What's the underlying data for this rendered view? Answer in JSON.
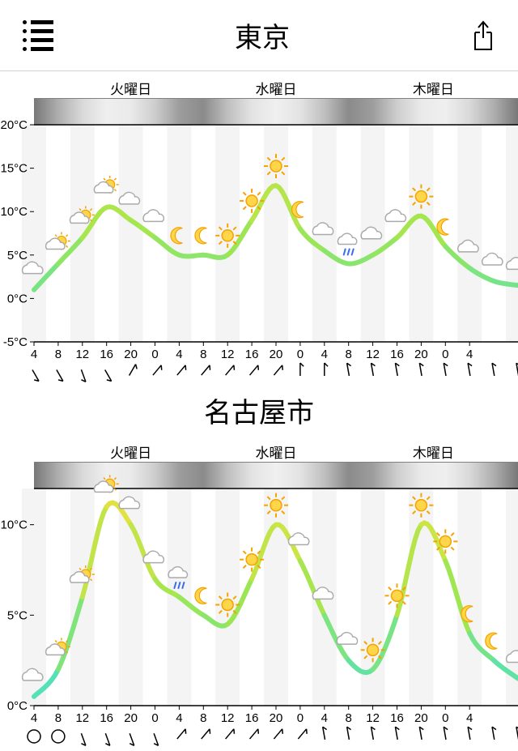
{
  "header": {
    "title": "東京"
  },
  "second_title": "名古屋市",
  "days": [
    "火曜日",
    "水曜日",
    "木曜日"
  ],
  "hours": [
    4,
    8,
    12,
    16,
    20,
    0,
    4,
    8,
    12,
    16,
    20,
    0,
    4,
    8,
    12,
    16,
    20,
    0,
    4
  ],
  "chart_data": [
    {
      "type": "line",
      "title": "東京",
      "xlabel": "",
      "ylabel": "°C",
      "ylim": [
        -5,
        20
      ],
      "x_hours": [
        4,
        8,
        12,
        16,
        20,
        0,
        4,
        8,
        12,
        16,
        20,
        0,
        4,
        8,
        12,
        16,
        20,
        0,
        4
      ],
      "series": [
        {
          "name": "temperature_°C",
          "values": [
            1,
            4,
            7,
            10.5,
            9,
            7,
            5,
            5,
            5,
            9,
            13,
            8,
            5.5,
            4,
            5,
            7,
            9.5,
            6,
            3.5,
            2,
            1.5
          ]
        }
      ],
      "conditions": [
        "cloud",
        "partly",
        "partly",
        "partly",
        "cloud",
        "cloud",
        "moon",
        "moon",
        "sunny",
        "sunny",
        "sunny",
        "moon",
        "cloud",
        "rain",
        "cloud",
        "cloud",
        "sunny",
        "moon",
        "cloud",
        "cloud",
        "cloud"
      ],
      "wind_dir_deg": [
        150,
        150,
        160,
        150,
        30,
        40,
        40,
        40,
        40,
        40,
        40,
        0,
        0,
        350,
        350,
        350,
        350,
        350,
        350,
        350,
        350
      ],
      "y_ticks": [
        -5,
        0,
        5,
        10,
        15,
        20
      ]
    },
    {
      "type": "line",
      "title": "名古屋市",
      "xlabel": "",
      "ylabel": "°C",
      "ylim": [
        0,
        12
      ],
      "x_hours": [
        4,
        8,
        12,
        16,
        20,
        0,
        4,
        8,
        12,
        16,
        20,
        0,
        4,
        8,
        12,
        16,
        20,
        0,
        4
      ],
      "series": [
        {
          "name": "temperature_°C",
          "values": [
            0.5,
            2,
            6,
            11,
            10,
            7,
            6,
            5,
            4.5,
            7,
            10,
            8,
            5,
            2.5,
            2,
            5,
            10,
            8,
            4,
            2.5,
            1.5
          ]
        }
      ],
      "conditions": [
        "cloud",
        "partly",
        "partly",
        "partly",
        "cloud",
        "cloud",
        "rain",
        "moon",
        "sunny",
        "sunny",
        "sunny",
        "cloud",
        "cloud",
        "cloud",
        "sunny",
        "sunny",
        "sunny",
        "sunny",
        "moon",
        "moon",
        "cloud"
      ],
      "wind_dir_deg": [
        0,
        0,
        160,
        160,
        160,
        160,
        40,
        40,
        40,
        40,
        40,
        40,
        350,
        350,
        350,
        350,
        350,
        350,
        350,
        350,
        350
      ],
      "wind_calm_idx": [
        0,
        1
      ],
      "y_ticks": [
        0,
        5,
        10
      ]
    }
  ]
}
